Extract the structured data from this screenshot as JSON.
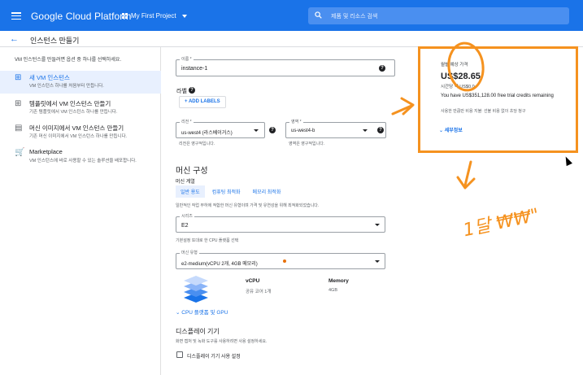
{
  "header": {
    "product_name": "Google Cloud Platform",
    "project_name": "My First Project",
    "search_placeholder": "제품 및 리소스 검색"
  },
  "page": {
    "title": "인스턴스 만들기"
  },
  "left_panel": {
    "description": "VM 인스턴스를 만들려면 옵션 중 하나를 선택하세요.",
    "options": [
      {
        "title": "새 VM 인스턴스",
        "subtitle": "VM 인스턴스 하나를 처음부터 만듭니다.",
        "icon": "plus-box-icon",
        "active": true
      },
      {
        "title": "템플릿에서 VM 인스턴스 만들기",
        "subtitle": "기존 템플릿에서 VM 인스턴스 하나를 만듭니다.",
        "icon": "template-icon",
        "active": false
      },
      {
        "title": "머신 이미지에서 VM 인스턴스 만들기",
        "subtitle": "기존 머신 이미지에서 VM 인스턴스 하나를 만듭니다.",
        "icon": "machine-image-icon",
        "active": false
      },
      {
        "title": "Marketplace",
        "subtitle": "VM 인스턴스에 바로 사용할 수 있는 솔루션을 배포합니다.",
        "icon": "cart-icon",
        "active": false
      }
    ]
  },
  "form": {
    "name_label": "이름 *",
    "name_value": "instance-1",
    "labels_title": "라벨",
    "add_labels": "+ ADD LABELS",
    "region_label": "리전 *",
    "region_value": "us-west4 (라스베이거스)",
    "region_hint": "리전은 영구적입니다.",
    "zone_label": "영역 *",
    "zone_value": "us-west4-b",
    "zone_hint": "영역은 영구적입니다.",
    "machine_config_title": "머신 구성",
    "machine_family_label": "머신 계열",
    "tabs": [
      "일반 용도",
      "컴퓨팅 최적화",
      "메모리 최적화"
    ],
    "family_desc": "일반적인 작업 부하에 적합한 머신 유형이며 가격 및 유연성을 위해 최적화되었습니다.",
    "series_label": "시리즈",
    "series_value": "E2",
    "series_hint": "기본설정 또대로 한 CPU 플랫폼 선택",
    "machine_type_label": "머신 유형",
    "machine_type_value": "e2-medium(vCPU 2개, 4GB 메모리)",
    "vcpu_header": "vCPU",
    "vcpu_value": "공유 코어 1개",
    "memory_header": "Memory",
    "memory_value": "4GB",
    "gpu_link": "CPU 플랫폼 및 GPU",
    "display_title": "디스플레이 기기",
    "display_desc": "화면 캡처 및 녹화 도구를 사용하려면 사용 설정하세요.",
    "display_checkbox": "디스플레이 기기 사용 설정"
  },
  "price": {
    "label": "월별 예상 가격",
    "amount": "US$28.65",
    "hourly": "시간당 약 US$0.0",
    "credits": "You have US$351,128.00 free trial credits remaining",
    "note": "사용한 만큼만 비용 지불: 선불 비용 없이 초당 청구",
    "details_link": "세부정보"
  },
  "annotation": {
    "handwriting": "1달 ₩₩\"",
    "accent_color": "#f5921f"
  },
  "colors": {
    "brand_blue": "#1a73e8",
    "annotation_orange": "#f5921f"
  }
}
